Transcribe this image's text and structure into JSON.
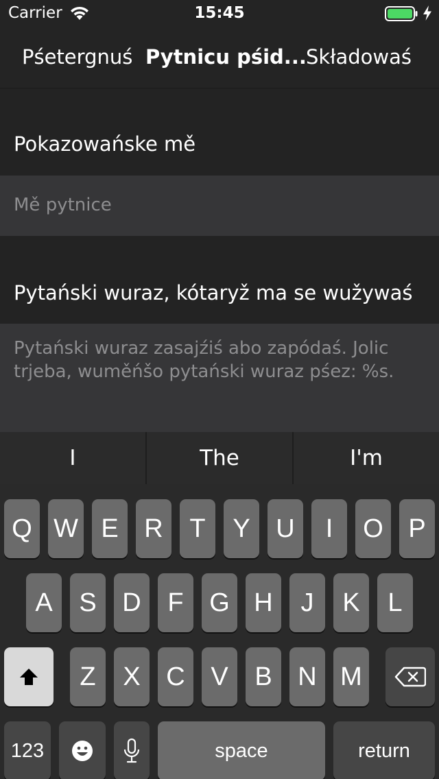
{
  "status_bar": {
    "carrier": "Carrier",
    "time": "15:45",
    "battery_color": "#4cd964"
  },
  "nav": {
    "back_label": "Pśetergnuś",
    "title": "Pytnicu pśid...",
    "save_label": "Składowaś"
  },
  "form": {
    "name_section_label": "Pokazowańske mě",
    "name_placeholder": "Mě pytnice",
    "query_section_label": "Pytański wuraz, kótaryž ma se wužywaś",
    "query_placeholder": "Pytański wuraz zasajźiś abo zapódaś. Jolic trjeba, wuměńšo pytański wuraz pśez: %s."
  },
  "suggestions": [
    "I",
    "The",
    "I'm"
  ],
  "keyboard": {
    "row1": [
      "Q",
      "W",
      "E",
      "R",
      "T",
      "Y",
      "U",
      "I",
      "O",
      "P"
    ],
    "row2": [
      "A",
      "S",
      "D",
      "F",
      "G",
      "H",
      "J",
      "K",
      "L"
    ],
    "row3": [
      "Z",
      "X",
      "C",
      "V",
      "B",
      "N",
      "M"
    ],
    "shift_icon": "shift-icon",
    "delete_icon": "delete-icon",
    "numbers_label": "123",
    "emoji_icon": "emoji-icon",
    "mic_icon": "microphone-icon",
    "space_label": "space",
    "return_label": "return"
  }
}
